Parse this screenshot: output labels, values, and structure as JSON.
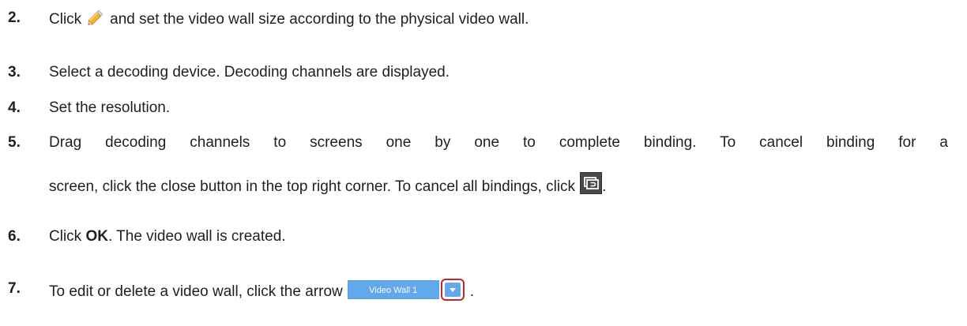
{
  "steps": [
    {
      "num": "2.",
      "before_icon": "Click",
      "icon": "pencil-icon",
      "after_icon": "and set the video wall size according to the physical video wall."
    },
    {
      "num": "3.",
      "text": "Select a decoding device. Decoding channels are displayed."
    },
    {
      "num": "4.",
      "text": "Set the resolution."
    },
    {
      "num": "5.",
      "line1": "Drag decoding channels to screens one by one to complete binding. To cancel binding for a",
      "line2": "screen, click the close button in the top right corner. To cancel all bindings, click",
      "icon": "unbind-all-icon",
      "end": "."
    },
    {
      "num": "6.",
      "before_bold": "Click",
      "bold": "OK",
      "after_bold": ". The video wall is created."
    },
    {
      "num": "7.",
      "text": "To edit or delete a video wall, click the arrow",
      "selector_value": "Video Wall 1",
      "icon": "dropdown-arrow-icon",
      "end": "."
    }
  ],
  "colors": {
    "accent_blue": "#62a8ec",
    "highlight_red": "#c0282f",
    "icon_dark": "#4a4a4a"
  }
}
